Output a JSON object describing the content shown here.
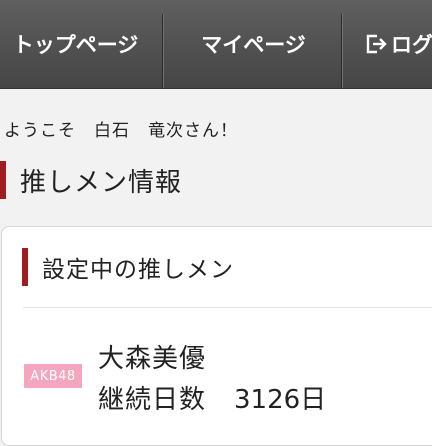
{
  "nav": {
    "items": [
      {
        "label": "トップページ"
      },
      {
        "label": "マイページ"
      },
      {
        "label": "ログ"
      }
    ]
  },
  "welcome": {
    "text": "ようこそ　白石　竜次さん！"
  },
  "section": {
    "title": "推しメン情報"
  },
  "card": {
    "title": "設定中の推しメン",
    "group_badge": "AKB48",
    "member_name": "大森美優",
    "streak_label": "継続日数",
    "streak_value": "3126日"
  },
  "colors": {
    "nav_bg": "#4f4f4f",
    "accent_bar": "#a01d22",
    "badge_bg": "#f3a7bf",
    "page_bg": "#f2f2f2",
    "card_bg": "#ffffff"
  },
  "icons": {
    "logout": "logout-icon"
  }
}
